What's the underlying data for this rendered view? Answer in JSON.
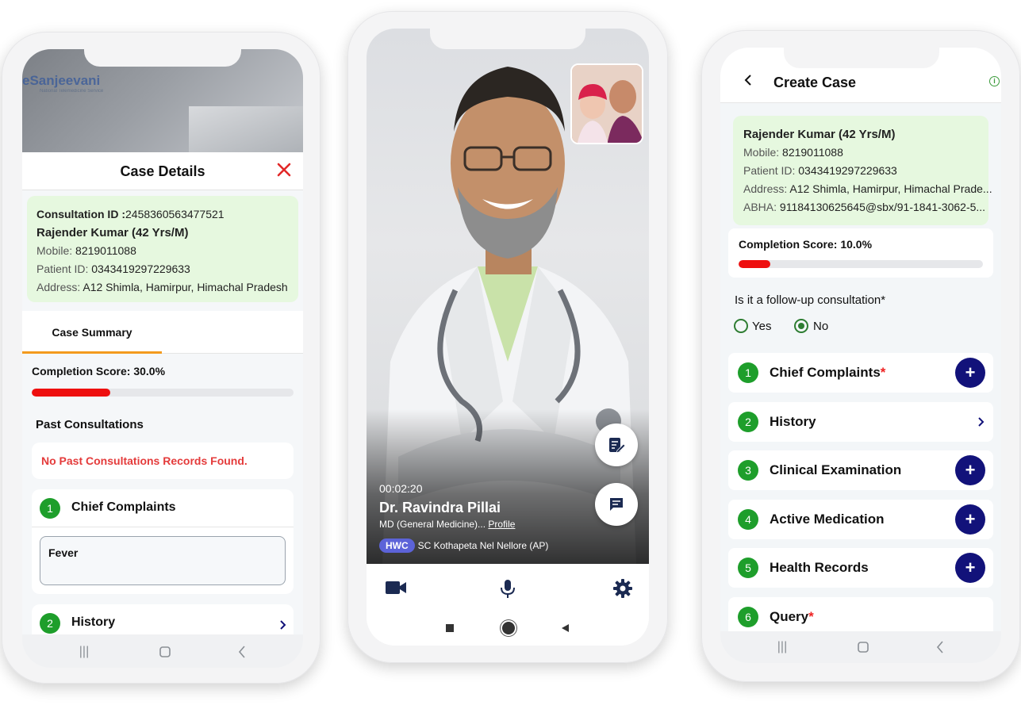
{
  "left_phone": {
    "logo": "eSanjeevani",
    "logo_sub": "National Telemedicine Service",
    "sheet_title": "Case Details",
    "consultation_label": "Consultation ID :",
    "consultation_id": "2458360563477521",
    "patient_name": "Rajender Kumar (42 Yrs/M)",
    "mobile_label": "Mobile:",
    "mobile": "8219011088",
    "patient_id_label": "Patient ID:",
    "patient_id": "0343419297229633",
    "address_label": "Address:",
    "address": "A12 Shimla, Hamirpur, Himachal Pradesh",
    "tab_label": "Case Summary",
    "completion_score": "Completion Score: 30.0%",
    "completion_fraction": 0.3,
    "past_title": "Past Consultations",
    "no_past": "No Past Consultations Records Found.",
    "item1_num": "1",
    "item1_label": "Chief Complaints",
    "complaint_value": "Fever",
    "item2_num": "2",
    "item2_label": "History"
  },
  "video_call": {
    "timer": "00:02:20",
    "doctor_name": "Dr. Ravindra Pillai",
    "doctor_spec": "MD (General Medicine)...",
    "profile_link": "Profile",
    "facility_badge": "HWC",
    "facility": "SC Kothapeta Nel Nellore (AP)",
    "icons": [
      "notes-icon",
      "chat-icon",
      "video-camera-icon",
      "microphone-icon",
      "settings-icon"
    ]
  },
  "right_phone": {
    "title": "Create Case",
    "patient_name": "Rajender Kumar (42 Yrs/M)",
    "mobile_label": "Mobile:",
    "mobile": "8219011088",
    "patient_id_label": "Patient ID:",
    "patient_id": "0343419297229633",
    "address_label": "Address:",
    "address": "A12 Shimla, Hamirpur, Himachal Prade...",
    "abha_label": "ABHA:",
    "abha": "91184130625645@sbx/91-1841-3062-5...",
    "completion_score": "Completion Score: 10.0%",
    "completion_fraction": 0.1,
    "followup_question": "Is it a follow-up consultation*",
    "yes_label": "Yes",
    "no_label": "No",
    "selected": "No",
    "sections": [
      {
        "num": "1",
        "label": "Chief Complaints",
        "required": true,
        "action": "add"
      },
      {
        "num": "2",
        "label": "History",
        "required": false,
        "action": "open"
      },
      {
        "num": "3",
        "label": "Clinical Examination",
        "required": false,
        "action": "add"
      },
      {
        "num": "4",
        "label": "Active Medication",
        "required": false,
        "action": "add"
      },
      {
        "num": "5",
        "label": "Health Records",
        "required": false,
        "action": "add"
      },
      {
        "num": "6",
        "label": "Query",
        "required": true,
        "action": "none"
      }
    ],
    "required_mark": "*",
    "plus_symbol": "+"
  },
  "colors": {
    "accent_green": "#1e9e2b",
    "card_green": "#e6f8df",
    "progress_red": "#ee0f0f",
    "tab_orange": "#f39a1e",
    "plus_navy": "#12127a",
    "hwc_purple": "#5c63d8",
    "error_red": "#e43b3b"
  }
}
